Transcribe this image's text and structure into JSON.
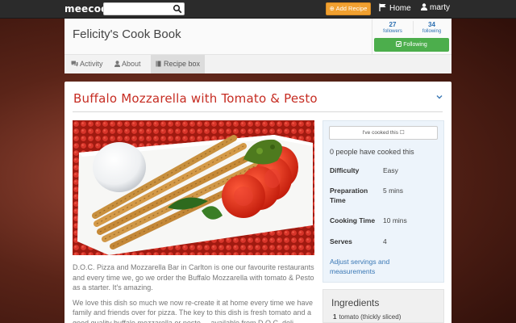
{
  "navbar": {
    "logo": "meecook",
    "search_placeholder": "",
    "add_recipe_label": "Add Recipe",
    "home_label": "Home",
    "user_label": "marty"
  },
  "profile": {
    "title": "Felicity's Cook Book",
    "followers_count": "27",
    "followers_label": "followers",
    "following_count": "34",
    "following_label": "following",
    "following_button": "Following",
    "tabs": [
      {
        "label": "Activity",
        "icon": "comments-icon",
        "active": false
      },
      {
        "label": "About",
        "icon": "user-icon",
        "active": false
      },
      {
        "label": "Recipe box",
        "icon": "book-icon",
        "active": true
      }
    ]
  },
  "recipe": {
    "title": "Buffalo Mozzarella with Tomato & Pesto",
    "description": [
      "D.O.C. Pizza and Mozzarella Bar in Carlton is one our favourite restaurants and every time we, go we order the Buffalo Mozzarella with tomato & Pesto as a starter. It's amazing.",
      "We love this dish so much we now re-create it at home every time we have family and friends over for pizza. The key to this dish is fresh tomato and a good quality buffalo mozzarella or pesto ... available from D.O.C. deli"
    ],
    "cooked_button": "I've cooked this",
    "cooked_count": "0 people have cooked this",
    "details": [
      {
        "label": "Difficulty",
        "value": "Easy"
      },
      {
        "label": "Preparation Time",
        "value": "5 mins"
      },
      {
        "label": "Cooking Time",
        "value": "10 mins"
      },
      {
        "label": "Serves",
        "value": "4"
      }
    ],
    "adjust_link": "Adjust servings and measurements",
    "ingredients_title": "Ingredients",
    "ingredients": [
      {
        "qty": "1",
        "text": "tomato (thickly sliced)"
      }
    ]
  },
  "colors": {
    "navbar": "#2b2b2b",
    "accent_orange": "#f0a030",
    "follow_green": "#4cae4c",
    "title_red": "#c62c22",
    "link_blue": "#3a78b5"
  }
}
